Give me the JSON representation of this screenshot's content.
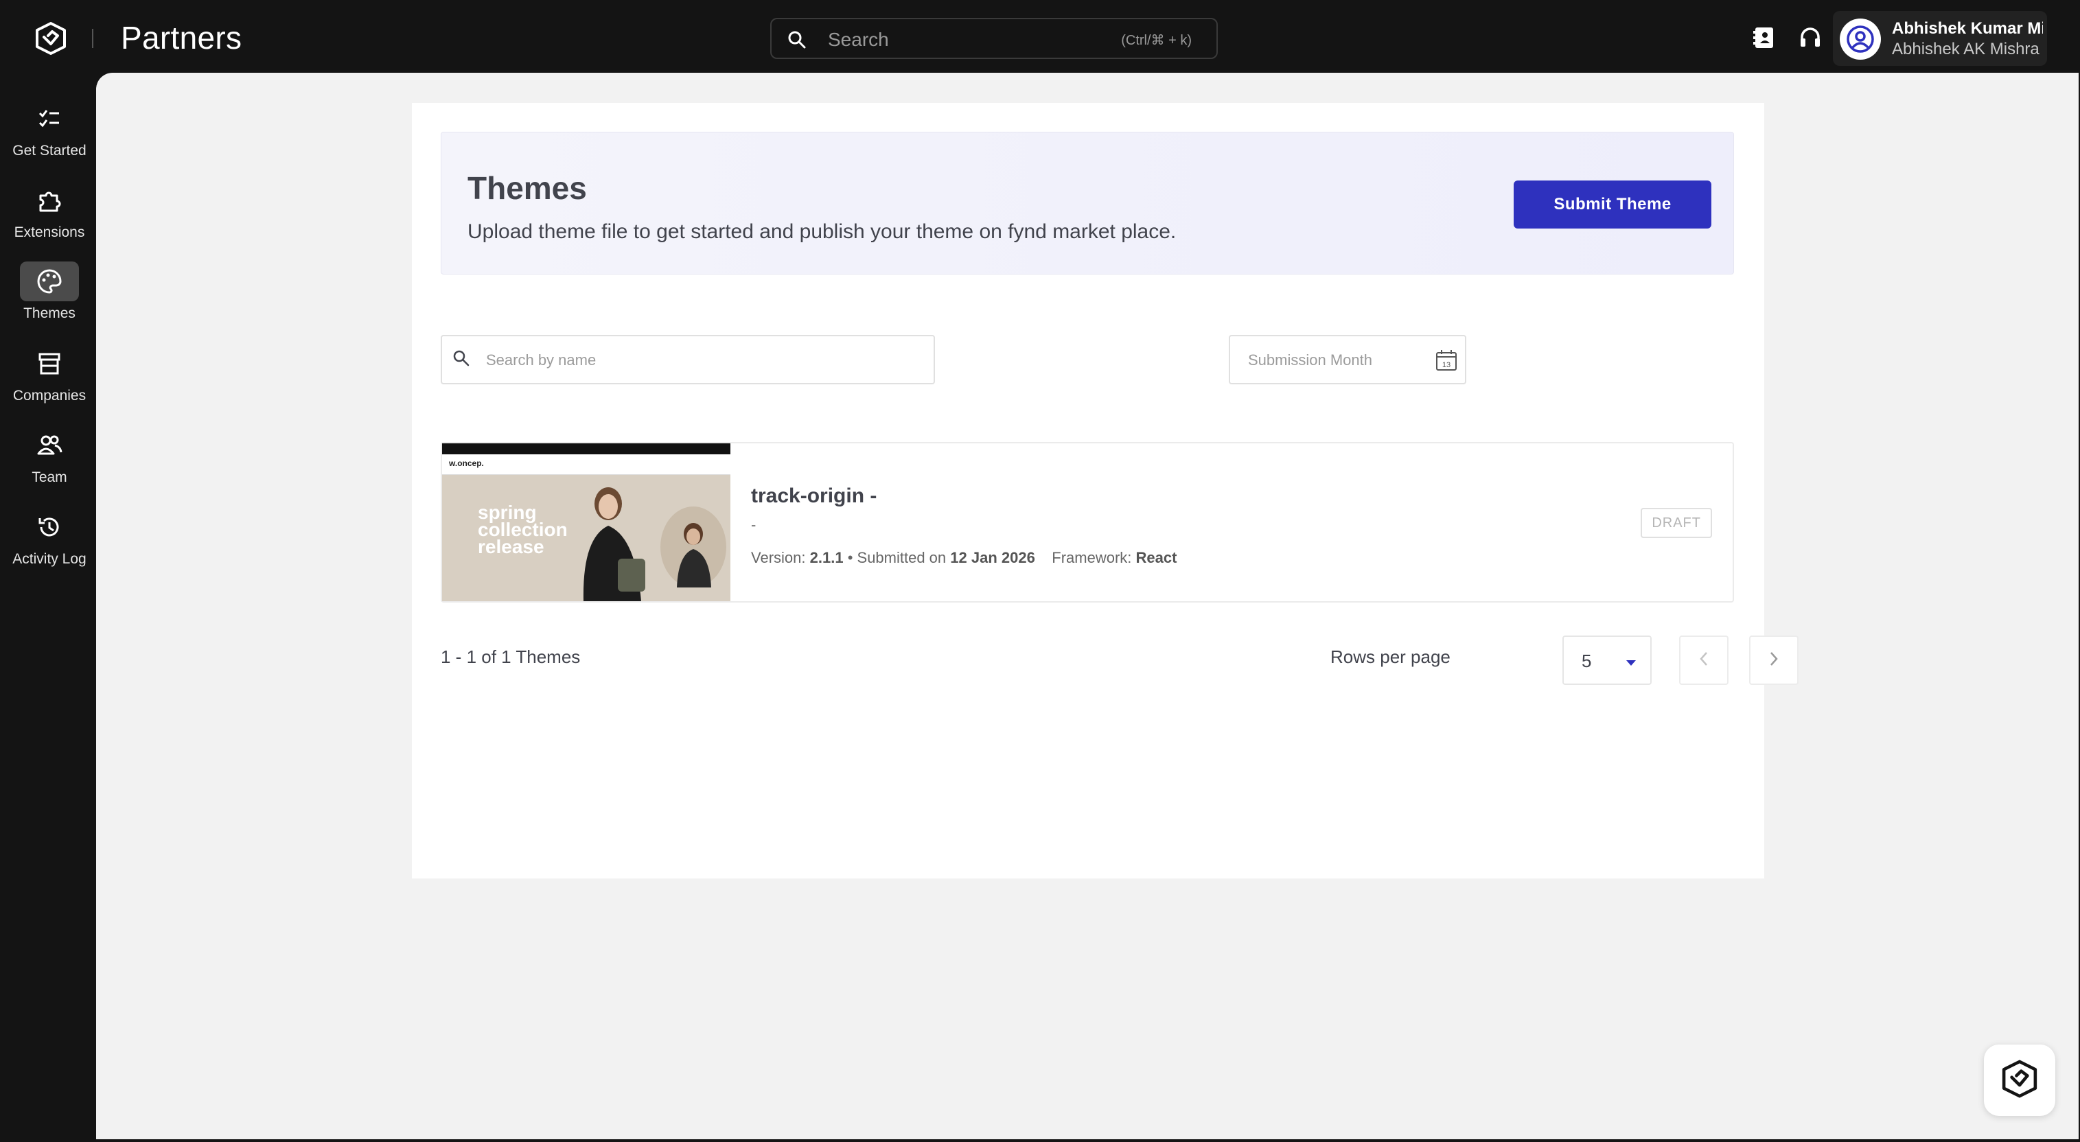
{
  "header": {
    "brand": "Partners",
    "search_placeholder": "Search",
    "search_shortcut": "(Ctrl/⌘ + k)",
    "user_name": "Abhishek Kumar Mi...",
    "user_org": "Abhishek AK Mishra"
  },
  "sidebar": {
    "items": [
      {
        "label": "Get Started",
        "icon": "checklist-icon"
      },
      {
        "label": "Extensions",
        "icon": "puzzle-icon"
      },
      {
        "label": "Themes",
        "icon": "palette-icon",
        "active": true
      },
      {
        "label": "Companies",
        "icon": "store-icon"
      },
      {
        "label": "Team",
        "icon": "team-icon"
      },
      {
        "label": "Activity Log",
        "icon": "history-icon"
      }
    ]
  },
  "banner": {
    "title": "Themes",
    "subtitle": "Upload theme file to get started and publish your theme on fynd market place.",
    "submit_label": "Submit Theme"
  },
  "filters": {
    "name_placeholder": "Search by name",
    "month_placeholder": "Submission Month",
    "calendar_day": "13"
  },
  "themes": [
    {
      "name": "track-origin -",
      "description": "-",
      "version_label": "Version:",
      "version": "2.1.1",
      "submitted_label": "Submitted on",
      "submitted_date": "12 Jan 2026",
      "framework_label": "Framework:",
      "framework": "React",
      "status": "DRAFT",
      "thumbnail": {
        "brand": "w.oncep.",
        "hero_text": "spring collection release"
      }
    }
  ],
  "pagination": {
    "summary": "1 - 1 of 1 Themes",
    "rows_label": "Rows per page",
    "rows_value": "5"
  },
  "colors": {
    "accent": "#2e31be",
    "dark_bg": "#141414",
    "main_bg": "#f2f2f2"
  }
}
